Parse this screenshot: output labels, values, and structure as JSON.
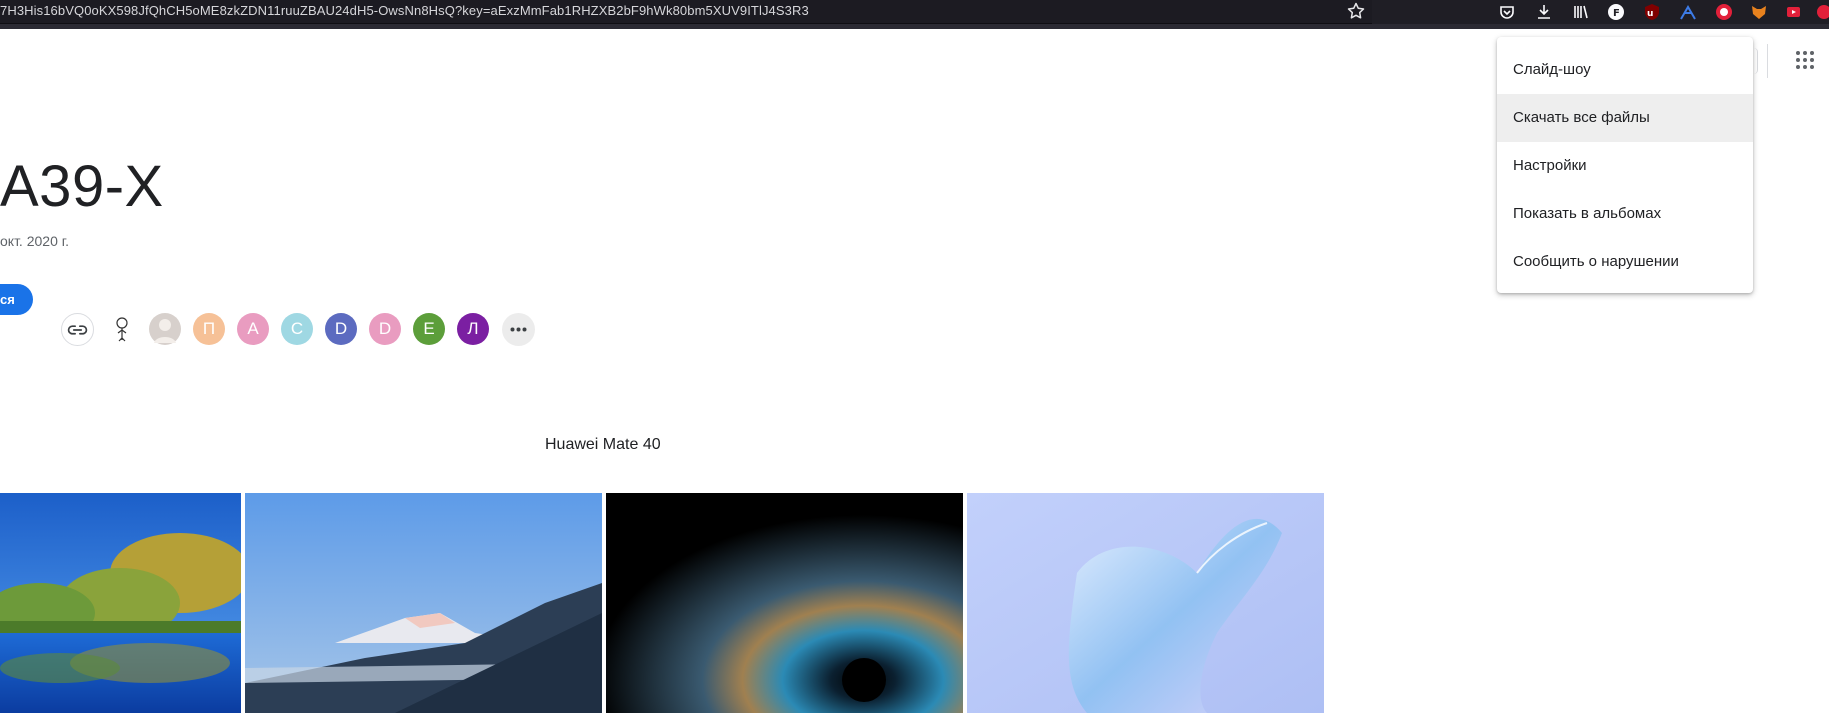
{
  "browser": {
    "url": "7H3His16bVQ0oKX598JfQhCH5oME8zkZDN11ruuZBAU24dH5-OwsNn8HsQ?key=aExzMmFab1RHZXB2bF9hWk80bm5XUV9ITlJ4S3R3",
    "toolbar_icons": [
      "pocket-icon",
      "download-icon",
      "library-icon",
      "extension-f-icon",
      "extension-ublock-icon",
      "extension-arrow-icon",
      "extension-record-icon",
      "extension-fox-icon",
      "extension-youtube-icon"
    ]
  },
  "album": {
    "title": "A39-X",
    "date": "окт. 2020 г.",
    "join_label": "ся"
  },
  "members": [
    {
      "letter": "",
      "color": "#ffffff",
      "kind": "drawing"
    },
    {
      "letter": "",
      "color": "#d7d0cc",
      "kind": "photo"
    },
    {
      "letter": "П",
      "color": "#f6c197"
    },
    {
      "letter": "А",
      "color": "#e99cc0"
    },
    {
      "letter": "С",
      "color": "#9fd8e3"
    },
    {
      "letter": "D",
      "color": "#5c6bc0"
    },
    {
      "letter": "D",
      "color": "#e99cc0"
    },
    {
      "letter": "Е",
      "color": "#5c9e3a"
    },
    {
      "letter": "Л",
      "color": "#7b1fa2"
    }
  ],
  "caption": "Huawei Mate 40",
  "menu": {
    "items": [
      {
        "label": "Слайд-шоу"
      },
      {
        "label": "Скачать все файлы"
      },
      {
        "label": "Настройки"
      },
      {
        "label": "Показать в альбомах"
      },
      {
        "label": "Сообщить о нарушении"
      }
    ]
  },
  "colors": {
    "accent": "#1a73e8",
    "menu_hover": "#eeeeee",
    "browser_bg": "#1f1e25"
  }
}
